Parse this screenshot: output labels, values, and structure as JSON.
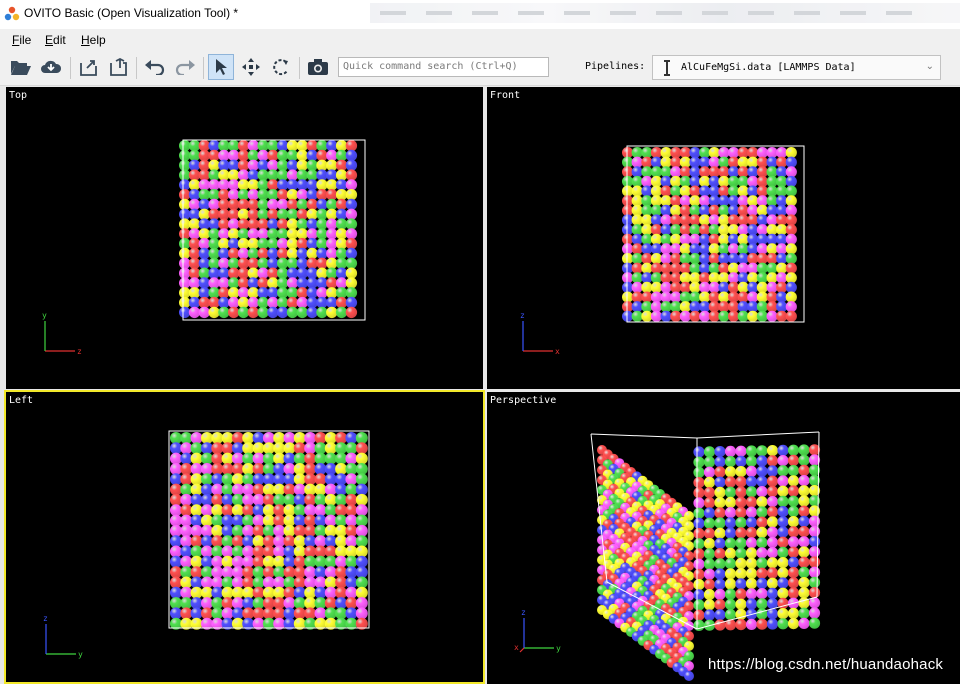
{
  "window": {
    "title": "OVITO Basic (Open Visualization Tool) *",
    "icon": "ovito-logo-icon"
  },
  "menu": {
    "items": [
      {
        "label": "File",
        "key": "F"
      },
      {
        "label": "Edit",
        "key": "E"
      },
      {
        "label": "Help",
        "key": "H"
      }
    ]
  },
  "toolbar": {
    "buttons": [
      {
        "name": "open-file-icon"
      },
      {
        "name": "load-remote-icon"
      },
      {
        "name": "export-file-icon"
      },
      {
        "name": "export-image-icon"
      },
      {
        "name": "undo-icon"
      },
      {
        "name": "redo-icon"
      },
      {
        "name": "select-mode-icon",
        "active": true
      },
      {
        "name": "move-mode-icon"
      },
      {
        "name": "rotate-mode-icon"
      },
      {
        "name": "render-camera-icon"
      }
    ],
    "search_placeholder": "Quick command search (Ctrl+Q)",
    "pipelines_label": "Pipelines:",
    "pipeline_selected": "AlCuFeMgSi.data [LAMMPS Data]"
  },
  "viewports": [
    {
      "caption": "Top",
      "axes": {
        "h": "x",
        "v": "y"
      },
      "active": false
    },
    {
      "caption": "Front",
      "axes": {
        "h": "x",
        "v": "z"
      },
      "active": false
    },
    {
      "caption": "Left",
      "axes": {
        "h": "y",
        "v": "z"
      },
      "active": true
    },
    {
      "caption": "Perspective",
      "axes": {
        "h": "y",
        "v": "z",
        "extra": "x"
      },
      "active": false
    }
  ],
  "atom_colors": [
    "#ff4f4f",
    "#4f4fff",
    "#4fe04f",
    "#ffff33",
    "#ff5fff"
  ],
  "watermark": "https://blog.csdn.net/huandaohack"
}
